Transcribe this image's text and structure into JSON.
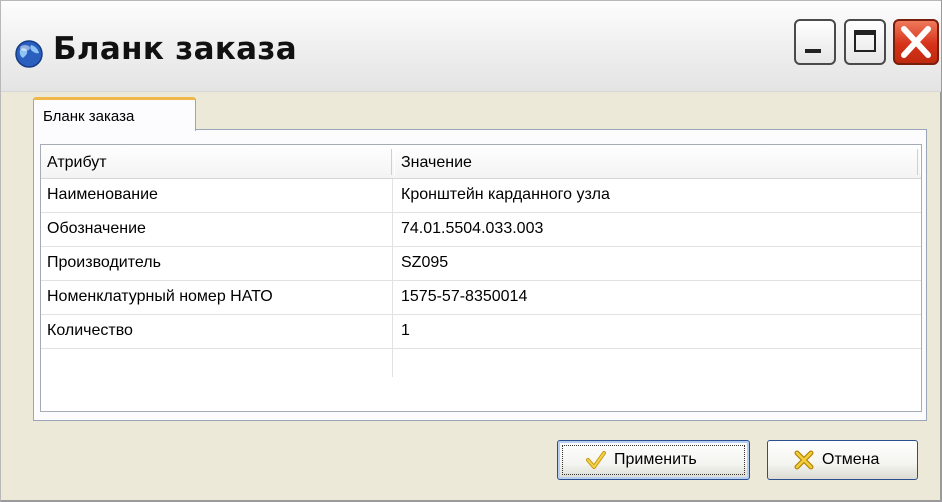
{
  "window": {
    "title": "Бланк заказа",
    "icon": "globe-icon"
  },
  "tabs": [
    {
      "label": "Бланк заказа",
      "active": true
    }
  ],
  "table": {
    "columns": [
      "Атрибут",
      "Значение"
    ],
    "rows": [
      {
        "attribute": "Наименование",
        "value": "Кронштейн карданного узла"
      },
      {
        "attribute": "Обозначение",
        "value": "74.01.5504.033.003"
      },
      {
        "attribute": "Производитель",
        "value": "SZ095"
      },
      {
        "attribute": "Номенклатурный номер НАТО",
        "value": "1575-57-8350014"
      },
      {
        "attribute": "Количество",
        "value": "1"
      }
    ]
  },
  "buttons": {
    "apply": {
      "label": "Применить",
      "icon": "checkmark-icon"
    },
    "cancel": {
      "label": "Отмена",
      "icon": "cross-icon"
    }
  },
  "colors": {
    "dialog_background": "#ece9d8",
    "tab_highlight": "#f0b84a",
    "close_button": "#d6331a",
    "focus_border": "#2b4e8c"
  }
}
